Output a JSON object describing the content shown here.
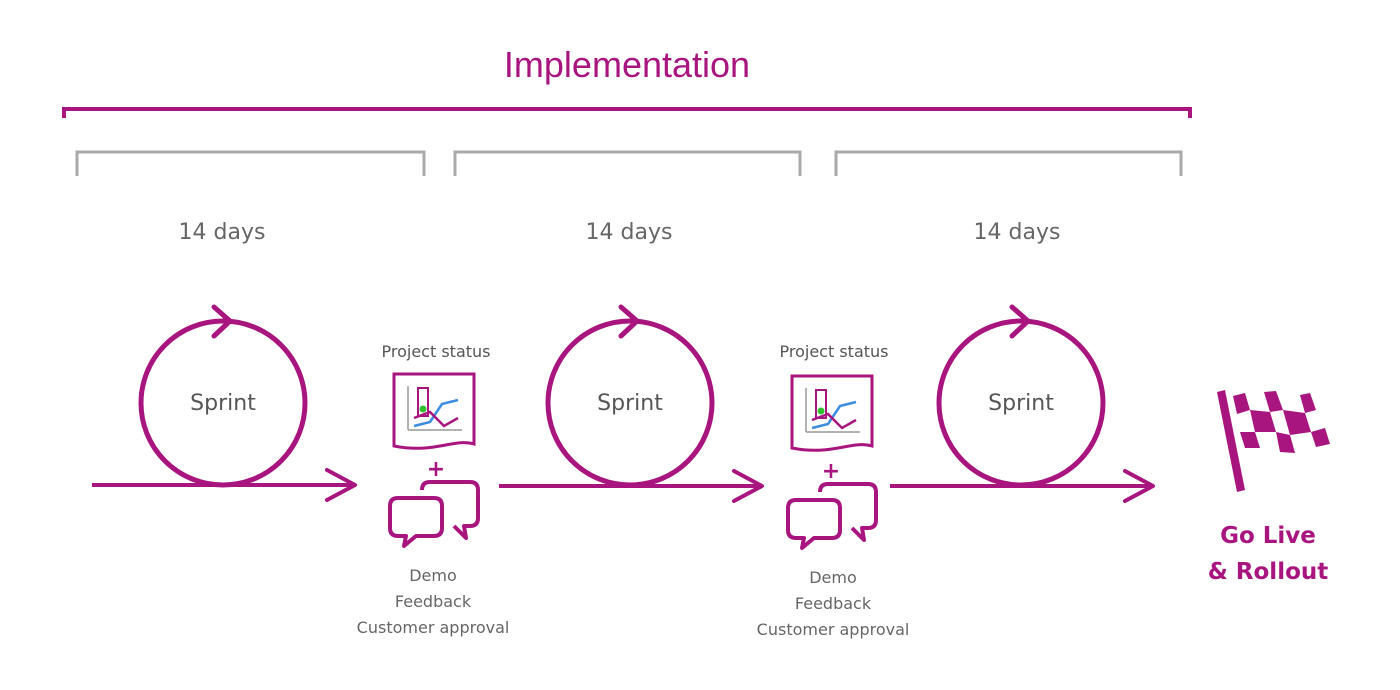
{
  "title": "Implementation",
  "colors": {
    "accent": "#a8157f",
    "bracket_gray": "#a9a9a9",
    "text_gray": "#666666",
    "chart_blue": "#3b8de0",
    "status_green": "#2fc02f"
  },
  "sprints": [
    {
      "duration": "14 days",
      "label": "Sprint"
    },
    {
      "duration": "14 days",
      "label": "Sprint"
    },
    {
      "duration": "14 days",
      "label": "Sprint"
    }
  ],
  "reviews": [
    {
      "heading": "Project status",
      "icon": "chart-document-icon",
      "connector": "+",
      "feedback_icon": "speech-bubbles-icon",
      "lines": [
        "Demo",
        "Feedback",
        "Customer approval"
      ]
    },
    {
      "heading": "Project status",
      "icon": "chart-document-icon",
      "connector": "+",
      "feedback_icon": "speech-bubbles-icon",
      "lines": [
        "Demo",
        "Feedback",
        "Customer approval"
      ]
    }
  ],
  "finish": {
    "icon": "checkered-flag-icon",
    "line1": "Go Live",
    "line2": "& Rollout"
  }
}
